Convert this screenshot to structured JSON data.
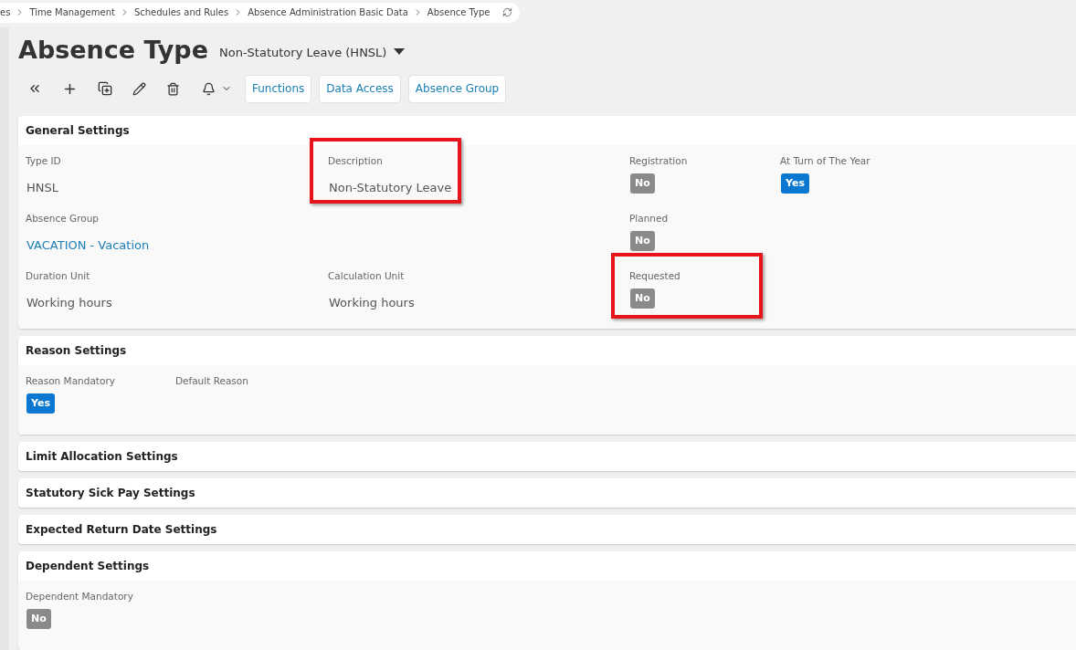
{
  "breadcrumb": {
    "items": [
      "es",
      "Time Management",
      "Schedules and Rules",
      "Absence Administration Basic Data",
      "Absence Type"
    ]
  },
  "header": {
    "title": "Absence Type",
    "record": "Non-Statutory Leave (HNSL)"
  },
  "toolbar": {
    "buttons": [
      "Functions",
      "Data Access",
      "Absence Group"
    ]
  },
  "sections": [
    {
      "title": "General Settings",
      "rows": [
        [
          {
            "label": "Type ID",
            "kind": "text",
            "value": "HNSL",
            "highlighted": false
          },
          {
            "label": "Description",
            "kind": "text",
            "value": "Non-Statutory Leave",
            "highlighted": true
          },
          {
            "label": "Registration",
            "kind": "bool",
            "value": "No",
            "on": false,
            "highlighted": false
          },
          {
            "label": "At Turn of The Year",
            "kind": "bool",
            "value": "Yes",
            "on": true,
            "highlighted": false
          }
        ],
        [
          {
            "label": "Absence Group",
            "kind": "link",
            "value": "VACATION - Vacation",
            "highlighted": false
          },
          null,
          {
            "label": "Planned",
            "kind": "bool",
            "value": "No",
            "on": false,
            "highlighted": false
          },
          null
        ],
        [
          {
            "label": "Duration Unit",
            "kind": "text",
            "value": "Working hours",
            "highlighted": false
          },
          {
            "label": "Calculation Unit",
            "kind": "text",
            "value": "Working hours",
            "highlighted": false
          },
          {
            "label": "Requested",
            "kind": "bool",
            "value": "No",
            "on": false,
            "highlighted": true
          },
          null
        ]
      ]
    },
    {
      "title": "Reason Settings",
      "rows": [
        [
          {
            "label": "Reason Mandatory",
            "kind": "bool",
            "value": "Yes",
            "on": true,
            "highlighted": false
          },
          {
            "label": "Default Reason",
            "kind": "empty",
            "highlighted": false
          }
        ]
      ]
    },
    {
      "title": "Limit Allocation Settings"
    },
    {
      "title": "Statutory Sick Pay Settings"
    },
    {
      "title": "Expected Return Date Settings"
    },
    {
      "title": "Dependent Settings",
      "rows": [
        [
          {
            "label": "Dependent Mandatory",
            "kind": "bool",
            "value": "No",
            "on": false,
            "highlighted": false
          }
        ]
      ]
    }
  ]
}
